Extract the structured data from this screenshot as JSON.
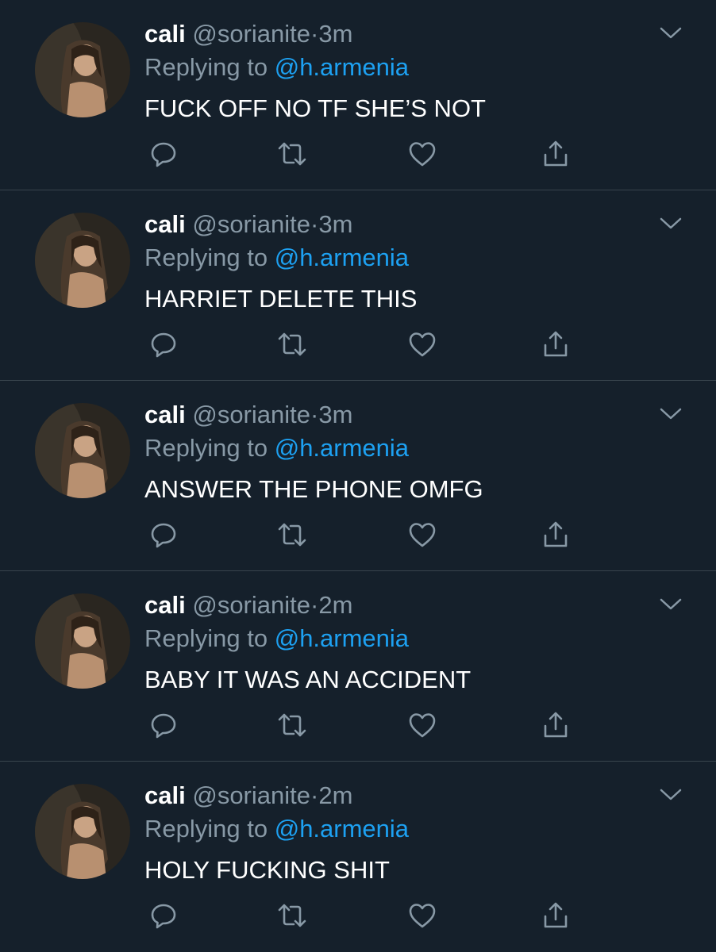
{
  "colors": {
    "background": "#15202b",
    "divider": "#38444d",
    "secondary_text": "#8899a6",
    "link": "#1da1f2",
    "primary_text": "#ffffff"
  },
  "icons": {
    "reply": "reply-icon",
    "retweet": "retweet-icon",
    "like": "heart-icon",
    "share": "share-icon",
    "menu": "chevron-down-icon"
  },
  "tweets": [
    {
      "name": "cali",
      "handle": "@sorianite",
      "separator": "·",
      "time": "3m",
      "replying_prefix": "Replying to",
      "replying_to": "@h.armenia",
      "text": "FUCK OFF NO TF SHE’S NOT"
    },
    {
      "name": "cali",
      "handle": "@sorianite",
      "separator": "·",
      "time": "3m",
      "replying_prefix": "Replying to",
      "replying_to": "@h.armenia",
      "text": "HARRIET DELETE THIS"
    },
    {
      "name": "cali",
      "handle": "@sorianite",
      "separator": "·",
      "time": "3m",
      "replying_prefix": "Replying to",
      "replying_to": "@h.armenia",
      "text": "ANSWER THE PHONE OMFG"
    },
    {
      "name": "cali",
      "handle": "@sorianite",
      "separator": "·",
      "time": "2m",
      "replying_prefix": "Replying to",
      "replying_to": "@h.armenia",
      "text": "BABY IT WAS AN ACCIDENT"
    },
    {
      "name": "cali",
      "handle": "@sorianite",
      "separator": "·",
      "time": "2m",
      "replying_prefix": "Replying to",
      "replying_to": "@h.armenia",
      "text": "HOLY FUCKING SHIT"
    }
  ]
}
